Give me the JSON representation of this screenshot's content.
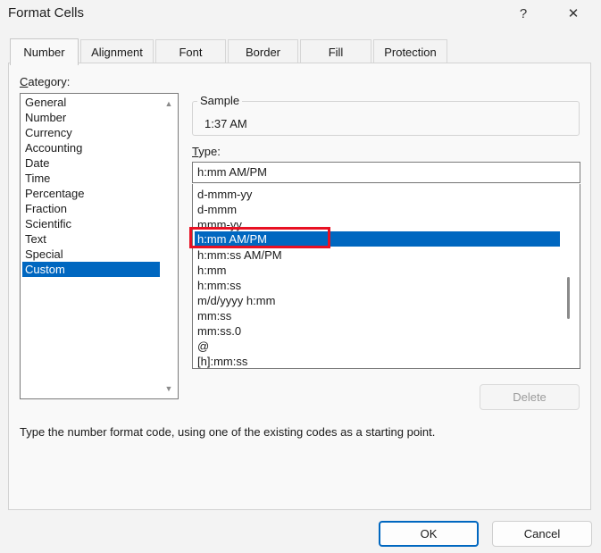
{
  "window": {
    "title": "Format Cells",
    "help_glyph": "?",
    "close_glyph": "✕"
  },
  "tabs": [
    {
      "label": "Number",
      "active": true
    },
    {
      "label": "Alignment",
      "active": false
    },
    {
      "label": "Font",
      "active": false
    },
    {
      "label": "Border",
      "active": false
    },
    {
      "label": "Fill",
      "active": false
    },
    {
      "label": "Protection",
      "active": false
    }
  ],
  "category": {
    "label": "Category:",
    "items": [
      "General",
      "Number",
      "Currency",
      "Accounting",
      "Date",
      "Time",
      "Percentage",
      "Fraction",
      "Scientific",
      "Text",
      "Special",
      "Custom"
    ],
    "selected": "Custom"
  },
  "sample": {
    "label": "Sample",
    "value": "1:37 AM"
  },
  "type": {
    "label": "Type:",
    "value": "h:mm AM/PM",
    "items": [
      "d-mmm-yy",
      "d-mmm",
      "mmm-yy",
      "h:mm AM/PM",
      "h:mm:ss AM/PM",
      "h:mm",
      "h:mm:ss",
      "m/d/yyyy h:mm",
      "mm:ss",
      "mm:ss.0",
      "@",
      "[h]:mm:ss"
    ],
    "selected": "h:mm AM/PM"
  },
  "buttons": {
    "delete": "Delete",
    "ok": "OK",
    "cancel": "Cancel"
  },
  "description": "Type the number format code, using one of the existing codes as a starting point.",
  "icons": {
    "scroll_up": "▲",
    "scroll_down": "▼"
  },
  "colors": {
    "selection": "#0067c0",
    "highlight": "#e81123"
  }
}
